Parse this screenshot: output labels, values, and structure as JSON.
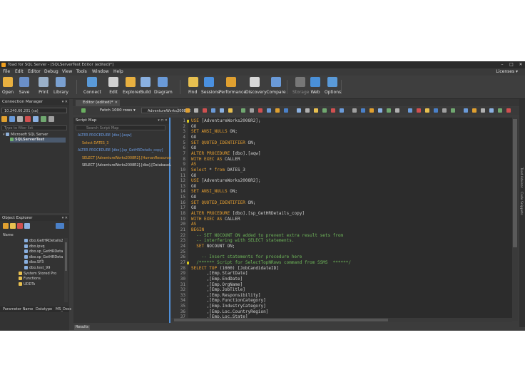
{
  "window": {
    "title": "Toad for SQL Server - [SQLServerTest Editor (edited)*]",
    "minimize": "–",
    "maximize": "□",
    "close": "✕"
  },
  "menu": [
    "File",
    "Edit",
    "Editor",
    "Debug",
    "View",
    "Tools",
    "Window",
    "Help"
  ],
  "licenses": "Licenses ▾",
  "ribbon": [
    {
      "label": "Open",
      "icon": "folder-open-icon",
      "color": "#e8b040"
    },
    {
      "label": "Save",
      "icon": "save-icon",
      "color": "#6a8fc8"
    },
    {
      "label": "Print",
      "icon": "print-icon",
      "color": "#9ab0c8"
    },
    {
      "label": "Library",
      "icon": "library-icon",
      "color": "#7aa0d0"
    },
    {
      "label": "Connect",
      "icon": "connect-icon",
      "color": "#5a9ad8"
    },
    {
      "label": "Edit",
      "icon": "edit-icon",
      "color": "#d0d0d0"
    },
    {
      "label": "Explorer",
      "icon": "explorer-icon",
      "color": "#e8b040"
    },
    {
      "label": "Build",
      "icon": "build-icon",
      "color": "#8ab0e0"
    },
    {
      "label": "Diagram",
      "icon": "diagram-icon",
      "color": "#6a9ad8"
    },
    {
      "label": "Find",
      "icon": "find-icon",
      "color": "#e8c050"
    },
    {
      "label": "Sessions",
      "icon": "sessions-icon",
      "color": "#4a90e0"
    },
    {
      "label": "Performance",
      "icon": "performance-icon",
      "color": "#e0a030"
    },
    {
      "label": "Discovery",
      "icon": "discovery-icon",
      "color": "#d8d8d8"
    },
    {
      "label": "Compare",
      "icon": "compare-icon",
      "color": "#6a9ad8"
    },
    {
      "label": "Storage",
      "icon": "storage-icon",
      "color": "#777777",
      "disabled": true
    },
    {
      "label": "Web",
      "icon": "web-icon",
      "color": "#4a90d8"
    },
    {
      "label": "Options",
      "icon": "options-icon",
      "color": "#5a9ad8"
    }
  ],
  "connection_manager": {
    "title": "Connection Manager",
    "server": "10.240.66.201 (sa)",
    "search_placeholder": "Type to filter list",
    "tree": [
      {
        "label": "Microsoft SQL Server"
      },
      {
        "label": "SQLServerTest",
        "selected": true
      }
    ]
  },
  "object_explorer": {
    "title": "Object Explorer",
    "node_name": "Name",
    "items": [
      "dbo.GetHRDetails2",
      "dbo.ipvq",
      "dbo.sp_GetHRDeta",
      "dbo.sp_GetHRDeta",
      "dbo.SP3",
      "dbo.test_99",
      "System Stored Pro",
      "Functions",
      "UDDTs"
    ],
    "props_cols": [
      "Parameter Name",
      "Datatype",
      "MS_Desc"
    ]
  },
  "editor": {
    "tab_label": "Editor (edited)*",
    "fetch_label": "Fetch 1000 rows ▾",
    "database": "AdventureWorks2008R2",
    "results_tab": "Results"
  },
  "script_map": {
    "title": "Script Map",
    "search_placeholder": "Search Script Map",
    "rows": [
      {
        "text": "ALTER PROCEDURE [dbo].[aqw]",
        "color": "#6a9ae0"
      },
      {
        "text": "Select DATES_3",
        "color": "#e8a030",
        "indent": 6
      },
      {
        "text": "ALTER PROCEDURE [dbo].[sp_GetHRDetails_copy]",
        "color": "#6a9ae0"
      },
      {
        "text": "SELECT [AdventureWorks2008R2].[HumanResources]",
        "color": "#e8a030",
        "indent": 6
      },
      {
        "text": "SELECT [AdventureWorks2008R2].[dbo].[DatabaseLog]",
        "color": "#d8d8d8",
        "indent": 6
      }
    ]
  },
  "code_lines": [
    {
      "n": "1",
      "segs": [
        [
          "kw",
          "USE "
        ],
        [
          "plain",
          "[AdventureWorks2008R2];"
        ]
      ]
    },
    {
      "n": "2",
      "segs": [
        [
          "plain",
          "GO"
        ]
      ]
    },
    {
      "n": "3",
      "segs": [
        [
          "kw",
          "SET "
        ],
        [
          "kw",
          "ANSI_NULLS "
        ],
        [
          "plain",
          "ON;"
        ]
      ]
    },
    {
      "n": "4",
      "segs": [
        [
          "plain",
          "GO"
        ]
      ]
    },
    {
      "n": "5",
      "segs": [
        [
          "kw",
          "SET "
        ],
        [
          "kw",
          "QUOTED_IDENTIFIER "
        ],
        [
          "plain",
          "ON;"
        ]
      ]
    },
    {
      "n": "6",
      "segs": [
        [
          "plain",
          "GO"
        ]
      ]
    },
    {
      "n": "7",
      "segs": [
        [
          "kw",
          "ALTER PROCEDURE "
        ],
        [
          "plain",
          "[dbo].[aqw]"
        ]
      ]
    },
    {
      "n": "8",
      "segs": [
        [
          "kw",
          "WITH EXEC AS "
        ],
        [
          "plain",
          "CALLER"
        ]
      ]
    },
    {
      "n": "9",
      "segs": [
        [
          "kw",
          "AS"
        ]
      ]
    },
    {
      "n": "10",
      "segs": [
        [
          "kw",
          "Select "
        ],
        [
          "plain",
          "* "
        ],
        [
          "kw",
          "from "
        ],
        [
          "plain",
          "DATES_3"
        ]
      ]
    },
    {
      "n": "11",
      "segs": [
        [
          "plain",
          "GO"
        ]
      ]
    },
    {
      "n": "12",
      "segs": [
        [
          "kw",
          "USE "
        ],
        [
          "plain",
          "[AdventureWorks2008R2];"
        ]
      ]
    },
    {
      "n": "13",
      "segs": [
        [
          "plain",
          "GO"
        ]
      ]
    },
    {
      "n": "14",
      "segs": [
        [
          "kw",
          "SET "
        ],
        [
          "kw",
          "ANSI_NULLS "
        ],
        [
          "plain",
          "ON;"
        ]
      ]
    },
    {
      "n": "15",
      "segs": [
        [
          "plain",
          "GO"
        ]
      ]
    },
    {
      "n": "16",
      "segs": [
        [
          "kw",
          "SET "
        ],
        [
          "kw",
          "QUOTED_IDENTIFIER "
        ],
        [
          "plain",
          "ON;"
        ]
      ]
    },
    {
      "n": "17",
      "segs": [
        [
          "plain",
          "GO"
        ]
      ]
    },
    {
      "n": "18",
      "segs": [
        [
          "kw",
          "ALTER PROCEDURE "
        ],
        [
          "plain",
          "[dbo].[sp_GetHRDetails_copy]"
        ]
      ]
    },
    {
      "n": "19",
      "segs": [
        [
          "kw",
          "WITH EXEC AS "
        ],
        [
          "plain",
          "CALLER"
        ]
      ]
    },
    {
      "n": "20",
      "segs": [
        [
          "kw",
          "AS"
        ]
      ]
    },
    {
      "n": "21",
      "segs": [
        [
          "kw",
          "BEGIN"
        ]
      ]
    },
    {
      "n": "22",
      "segs": [
        [
          "cmt",
          "  -- SET NOCOUNT ON added to prevent extra result sets from"
        ]
      ]
    },
    {
      "n": "23",
      "segs": [
        [
          "cmt",
          "  -- interfering with SELECT statements."
        ]
      ]
    },
    {
      "n": "24",
      "segs": [
        [
          "kw",
          "  SET "
        ],
        [
          "plain",
          "NOCOUNT ON;"
        ]
      ]
    },
    {
      "n": "25",
      "segs": [
        [
          "plain",
          ""
        ]
      ]
    },
    {
      "n": "26",
      "segs": [
        [
          "cmt",
          "    -- Insert statements for procedure here"
        ]
      ]
    },
    {
      "n": "27",
      "segs": [
        [
          "cmt",
          "  /****** Script for SelectTopNRows command from SSMS  ******/"
        ]
      ]
    },
    {
      "n": "28",
      "segs": [
        [
          "kw",
          "SELECT TOP "
        ],
        [
          "plain",
          "(1000) [JobCandidateID]"
        ]
      ]
    },
    {
      "n": "29",
      "segs": [
        [
          "plain",
          "      ,[Emp.StartDate]"
        ]
      ]
    },
    {
      "n": "30",
      "segs": [
        [
          "plain",
          "      ,[Emp.EndDate]"
        ]
      ]
    },
    {
      "n": "31",
      "segs": [
        [
          "plain",
          "      ,[Emp.OrgName]"
        ]
      ]
    },
    {
      "n": "32",
      "segs": [
        [
          "plain",
          "      ,[Emp.JobTitle]"
        ]
      ]
    },
    {
      "n": "33",
      "segs": [
        [
          "plain",
          "      ,[Emp.Responsibility]"
        ]
      ]
    },
    {
      "n": "34",
      "segs": [
        [
          "plain",
          "      ,[Emp.FunctionCategory]"
        ]
      ]
    },
    {
      "n": "35",
      "segs": [
        [
          "plain",
          "      ,[Emp.IndustryCategory]"
        ]
      ]
    },
    {
      "n": "36",
      "segs": [
        [
          "plain",
          "      ,[Emp.Loc.CountryRegion]"
        ]
      ]
    },
    {
      "n": "37",
      "segs": [
        [
          "plain",
          "      ,[Emp.Loc.State]"
        ]
      ]
    }
  ],
  "right_rail": [
    "Toad Advisor",
    "Code Snippets"
  ]
}
